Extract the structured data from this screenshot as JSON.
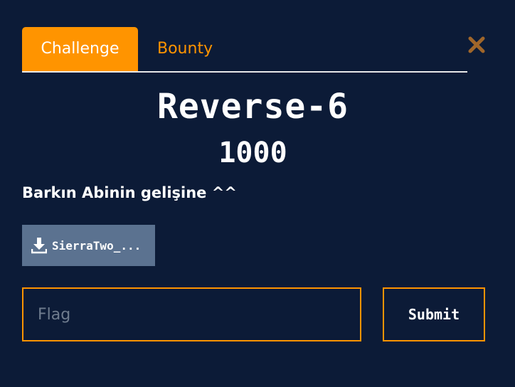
{
  "tabs": {
    "challenge_label": "Challenge",
    "bounty_label": "Bounty"
  },
  "close_icon": "close-icon",
  "challenge": {
    "name": "Reverse-6",
    "points": "1000",
    "description": "Barkın Abinin gelişine ^^"
  },
  "file": {
    "label": "SierraTwo_...",
    "icon": "download-icon"
  },
  "flag_input": {
    "placeholder": "Flag",
    "value": ""
  },
  "submit_label": "Submit",
  "colors": {
    "background": "#0c1b37",
    "accent": "#ff9400",
    "file_button": "#5b7290",
    "close": "#a0662a"
  }
}
